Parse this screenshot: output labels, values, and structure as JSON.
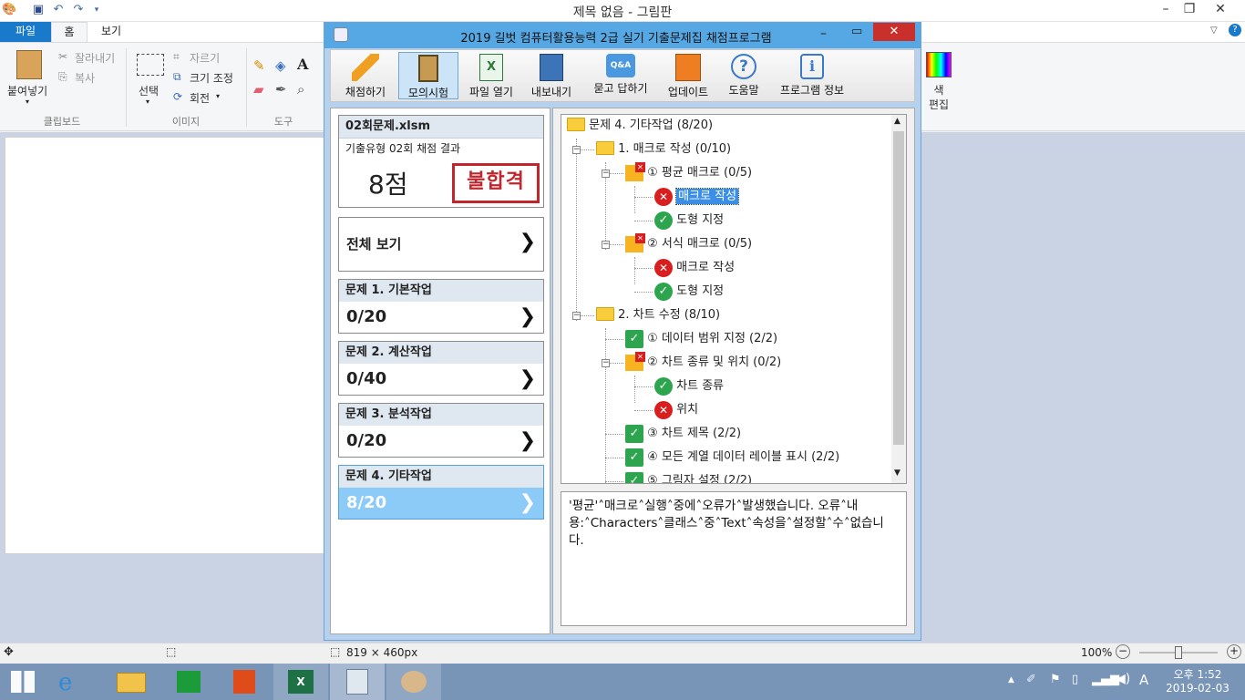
{
  "paint": {
    "title": "제목 없음 - 그림판",
    "tabs": [
      "파일",
      "홈",
      "보기"
    ],
    "ribbon": {
      "paste": "붙여넣기",
      "cut": "잘라내기",
      "copy": "복사",
      "clipboard_group": "클립보드",
      "select": "선택",
      "crop": "자르기",
      "resize": "크기 조정",
      "rotate": "회전",
      "image_group": "이미지",
      "tools_group": "도구",
      "color_edit": "색 편집"
    },
    "status": {
      "size": "819 × 460px",
      "zoom": "100%"
    }
  },
  "grader": {
    "title": "2019 길벗 컴퓨터활용능력 2급 실기 기출문제집 채점프로그램",
    "toolbar": [
      {
        "label": "채점하기",
        "icon": "pencil-icon"
      },
      {
        "label": "모의시험",
        "icon": "clipboard-icon"
      },
      {
        "label": "파일 열기",
        "icon": "excel-file-icon"
      },
      {
        "label": "내보내기",
        "icon": "save-icon"
      },
      {
        "label": "묻고 답하기",
        "icon": "qa-icon"
      },
      {
        "label": "업데이트",
        "icon": "gift-icon"
      },
      {
        "label": "도움말",
        "icon": "help-icon"
      },
      {
        "label": "프로그램 정보",
        "icon": "info-icon"
      }
    ],
    "result": {
      "file": "02회문제.xlsm",
      "subtitle": "기출유형 02회 채점 결과",
      "score": "8점",
      "stamp": "불합격"
    },
    "view_all": "전체 보기",
    "problems": [
      {
        "title": "문제 1. 기본작업",
        "score": "0/20"
      },
      {
        "title": "문제 2. 계산작업",
        "score": "0/40"
      },
      {
        "title": "문제 3. 분석작업",
        "score": "0/20"
      },
      {
        "title": "문제 4. 기타작업",
        "score": "8/20"
      }
    ],
    "tree": [
      "문제 4. 기타작업 (8/20)",
      "1. 매크로 작성 (0/10)",
      "① 평균 매크로 (0/5)",
      "매크로 작성",
      "도형 지정",
      "② 서식 매크로 (0/5)",
      "매크로 작성",
      "도형 지정",
      "2. 차트 수정 (8/10)",
      "① 데이터 범위 지정 (2/2)",
      "② 차트 종류 및 위치 (0/2)",
      "차트 종류",
      "위치",
      "③ 차트 제목 (2/2)",
      "④ 모든 계열 데이터 레이블 표시 (2/2)",
      "⑤ 그림자 설정 (2/2)"
    ],
    "message": "'평균'˄매크로˄실행˄중에˄오류가˄발생했습니다. 오류˄내용:˄Characters˄클래스˄중˄Text˄속성을˄설정할˄수˄없습니다."
  },
  "taskbar": {
    "time": "오후 1:52",
    "date": "2019-02-03",
    "ime": "A"
  },
  "colors": {
    "accent": "#56a8e4",
    "selected_card": "#8ccaf7",
    "error": "#d81e1e",
    "ok": "#2da44e"
  }
}
